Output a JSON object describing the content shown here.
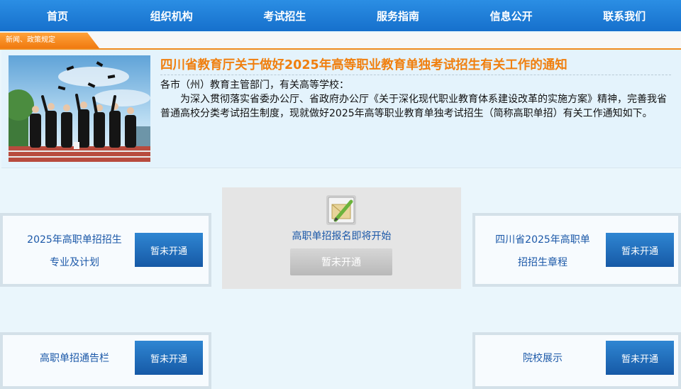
{
  "nav": {
    "items": [
      "首页",
      "组织机构",
      "考试招生",
      "服务指南",
      "信息公开",
      "联系我们"
    ]
  },
  "notice": {
    "tab_label": "新闻、政策规定"
  },
  "news": {
    "title": "四川省教育厅关于做好2025年高等职业教育单独考试招生有关工作的通知",
    "greeting": "各市（州）教育主管部门，有关高等学校：",
    "paragraph": "为深入贯彻落实省委办公厅、省政府办公厅《关于深化现代职业教育体系建设改革的实施方案》精神，完善我省普通高校分类考试招生制度，现就做好2025年高等职业教育单独考试招生（简称高职单招）有关工作通知如下。",
    "photo_icon": "graduation-photo"
  },
  "cards": {
    "plan": {
      "line1": "2025年高职单招招生",
      "line2": "专业及计划",
      "button": "暂未开通"
    },
    "regulation": {
      "line1": "四川省2025年高职单",
      "line2": "招招生章程",
      "button": "暂未开通"
    },
    "bulletin": {
      "label": "高职单招通告栏",
      "button": "暂未开通"
    },
    "schools": {
      "label": "院校展示",
      "button": "暂未开通"
    }
  },
  "registration": {
    "label": "高职单招报名即将开始",
    "button": "暂未开通",
    "icon": "edit-pencil-icon"
  },
  "colors": {
    "nav_bg": "#1f7fd9",
    "accent_orange": "#f07f0e",
    "button_blue": "#1a64b4",
    "link_blue": "#1b58a8"
  }
}
